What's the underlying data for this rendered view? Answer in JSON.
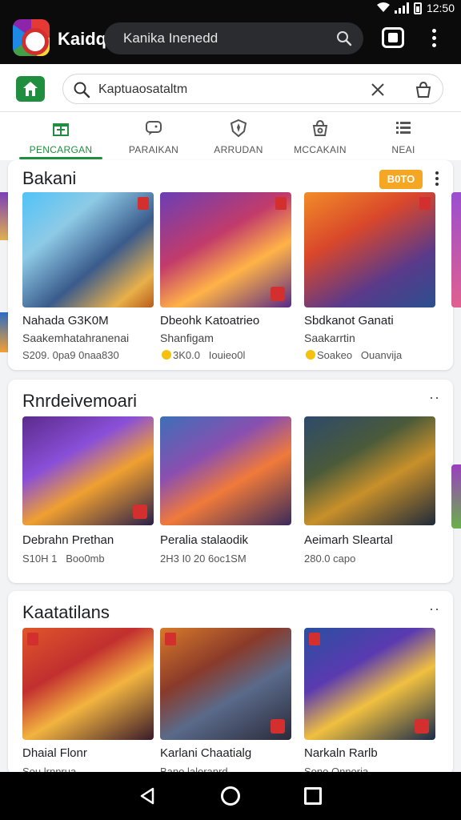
{
  "status_bar": {
    "time": "12:50"
  },
  "browser": {
    "app_name": "Kaidq",
    "url_text": "Kanika Inenedd"
  },
  "search": {
    "value": "Kaptuaosataltm"
  },
  "nav": {
    "tabs": [
      {
        "label": "PENCARGAN",
        "icon": "gift-icon",
        "active": true
      },
      {
        "label": "PARAIKAN",
        "icon": "chat-icon",
        "active": false
      },
      {
        "label": "ARRUDAN",
        "icon": "shield-icon",
        "active": false
      },
      {
        "label": "MCCAKAIN",
        "icon": "bag-icon",
        "active": false
      },
      {
        "label": "NEAI",
        "icon": "list-icon",
        "active": false
      }
    ]
  },
  "sections": [
    {
      "title": "Bakani",
      "badge": "B0TO",
      "items": [
        {
          "title": "Nahada G3K0M",
          "subtitle": "Saakemhatahranenai",
          "meta": "S209. 0pa9 0naa830"
        },
        {
          "title": "Dbeohk Katoatrieo",
          "subtitle": "Shanfigam",
          "meta": "3K0.0   Iouieo0l"
        },
        {
          "title": "Sbdkanot Ganati",
          "subtitle": "Saakarrtin",
          "meta": "Soakeo   Ouanvija"
        }
      ]
    },
    {
      "title": "Rnrdeivemoari",
      "items": [
        {
          "title": "Debrahn Prethan",
          "meta": "S10H 1   Boo0mb"
        },
        {
          "title": "Peralia stalaodik",
          "meta": "2H3 I0 20 6oc1SM"
        },
        {
          "title": "Aeimarh Sleartal",
          "meta": "280.0 capo"
        }
      ]
    },
    {
      "title": "Kaatatilans",
      "items": [
        {
          "title": "Dhaial Flonr",
          "meta": "Sou lrnnrua"
        },
        {
          "title": "Karlani Chaatialg",
          "meta": "Bano laloranrd"
        },
        {
          "title": "Narkaln Rarlb",
          "meta": "Sono Onnoria"
        }
      ]
    }
  ],
  "colors": {
    "accent": "#1f8f3f",
    "badge": "#f5a623",
    "topbar": "#0b0b0b"
  }
}
